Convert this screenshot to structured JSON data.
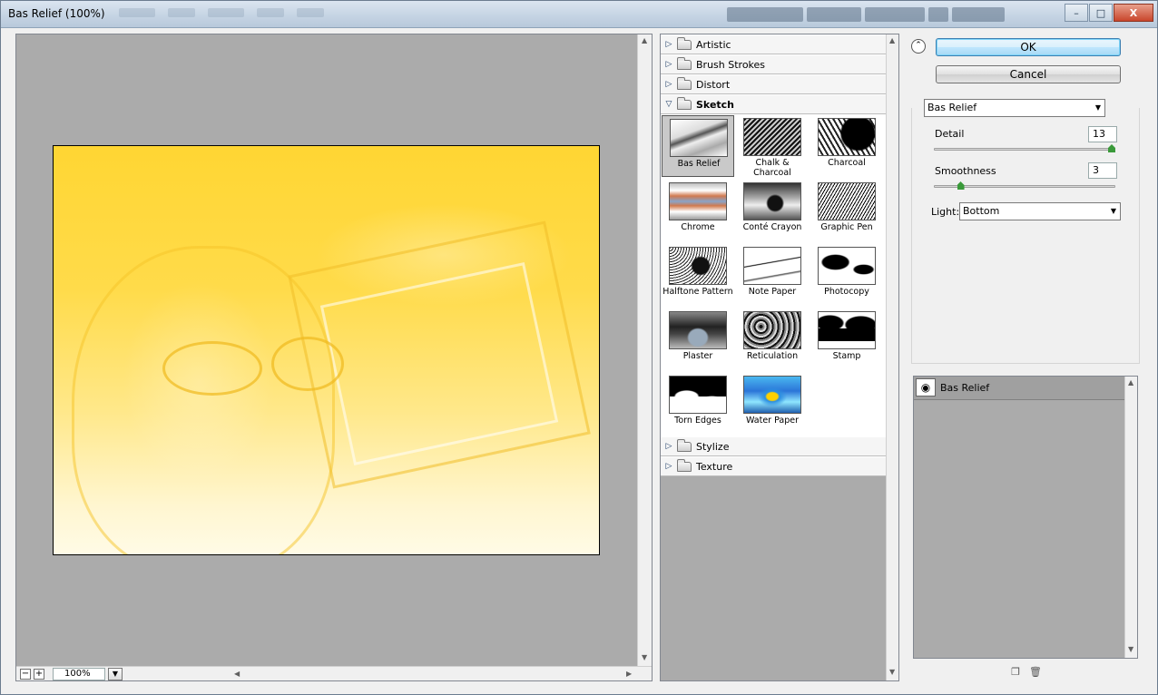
{
  "window": {
    "title": "Bas Relief (100%)",
    "controls": {
      "minimize": "–",
      "maximize": "□",
      "close": "X"
    }
  },
  "preview": {
    "zoom_out": "−",
    "zoom_in": "+",
    "zoom_level": "100%"
  },
  "gallery": {
    "categories_top": [
      {
        "label": "Artistic",
        "open": false
      },
      {
        "label": "Brush Strokes",
        "open": false
      },
      {
        "label": "Distort",
        "open": false
      },
      {
        "label": "Sketch",
        "open": true
      }
    ],
    "sketch_filters": [
      {
        "label": "Bas Relief",
        "texture": "t-basrelief",
        "selected": true
      },
      {
        "label": "Chalk & Charcoal",
        "texture": "t-chalk",
        "selected": false
      },
      {
        "label": "Charcoal",
        "texture": "t-charcoal",
        "selected": false
      },
      {
        "label": "Chrome",
        "texture": "t-chrome",
        "selected": false
      },
      {
        "label": "Conté Crayon",
        "texture": "t-conte",
        "selected": false
      },
      {
        "label": "Graphic Pen",
        "texture": "t-graphic",
        "selected": false
      },
      {
        "label": "Halftone Pattern",
        "texture": "t-halftone",
        "selected": false
      },
      {
        "label": "Note Paper",
        "texture": "t-note",
        "selected": false
      },
      {
        "label": "Photocopy",
        "texture": "t-photocopy",
        "selected": false
      },
      {
        "label": "Plaster",
        "texture": "t-plaster",
        "selected": false
      },
      {
        "label": "Reticulation",
        "texture": "t-reticulation",
        "selected": false
      },
      {
        "label": "Stamp",
        "texture": "t-stamp",
        "selected": false
      },
      {
        "label": "Torn Edges",
        "texture": "t-torn",
        "selected": false
      },
      {
        "label": "Water Paper",
        "texture": "t-water",
        "selected": false
      }
    ],
    "categories_bottom": [
      {
        "label": "Stylize",
        "open": false
      },
      {
        "label": "Texture",
        "open": false
      }
    ]
  },
  "actions": {
    "ok_label": "OK",
    "cancel_label": "Cancel"
  },
  "settings": {
    "filter_select": "Bas Relief",
    "detail_label": "Detail",
    "detail_value": "13",
    "detail_fraction": 1.0,
    "smoothness_label": "Smoothness",
    "smoothness_value": "3",
    "smoothness_fraction": 0.133,
    "light_label": "Light:",
    "light_value": "Bottom"
  },
  "layers": {
    "items": [
      {
        "name": "Bas Relief",
        "visible": true
      }
    ]
  }
}
